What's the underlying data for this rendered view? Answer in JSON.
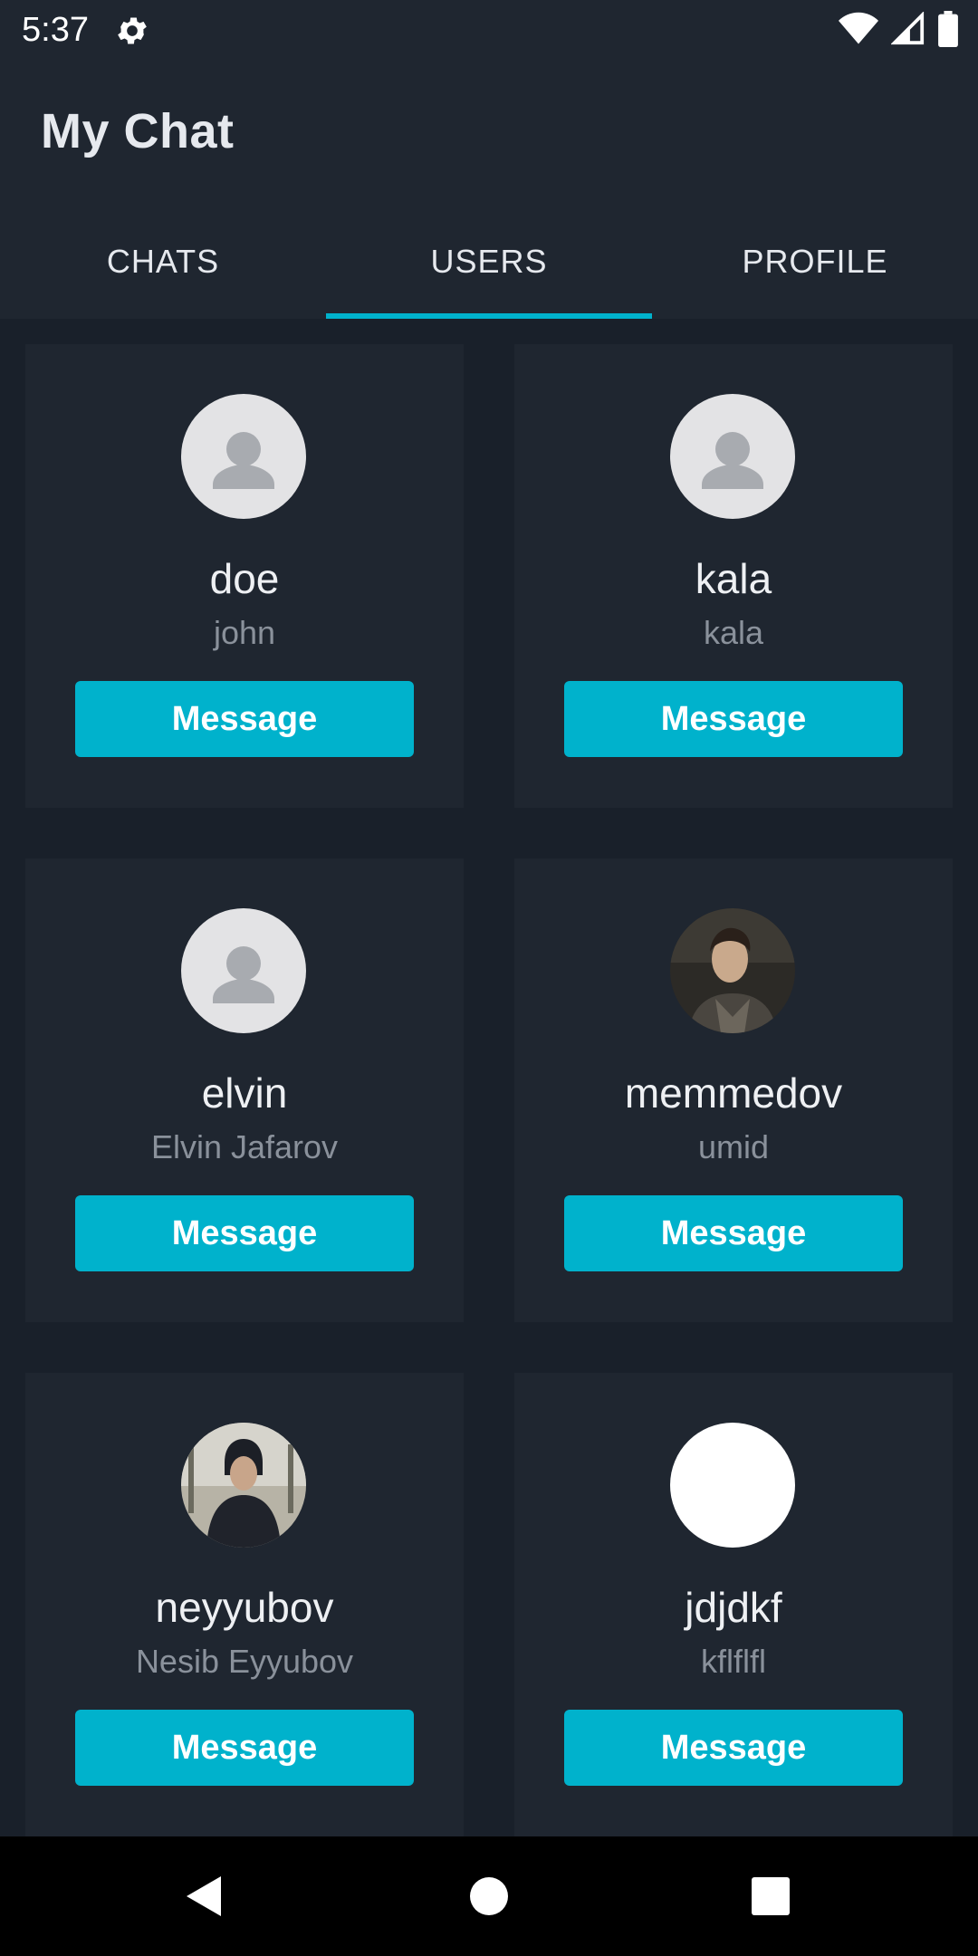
{
  "status_bar": {
    "time": "5:37",
    "icons": [
      "gear-icon",
      "wifi-icon",
      "signal-icon",
      "battery-icon"
    ]
  },
  "app": {
    "title": "My Chat",
    "tabs": [
      {
        "label": "CHATS",
        "active": false
      },
      {
        "label": "USERS",
        "active": true
      },
      {
        "label": "PROFILE",
        "active": false
      }
    ],
    "accent_color": "#00b2cc"
  },
  "users": [
    {
      "name": "doe",
      "subtitle": "john",
      "avatar": "default-person-icon",
      "button": "Message"
    },
    {
      "name": "kala",
      "subtitle": "kala",
      "avatar": "default-person-icon",
      "button": "Message"
    },
    {
      "name": "elvin",
      "subtitle": "Elvin Jafarov",
      "avatar": "default-person-icon",
      "button": "Message"
    },
    {
      "name": "memmedov",
      "subtitle": "umid",
      "avatar": "photo",
      "button": "Message"
    },
    {
      "name": "neyyubov",
      "subtitle": "Nesib Eyyubov",
      "avatar": "photo",
      "button": "Message"
    },
    {
      "name": "jdjdkf",
      "subtitle": "kflflfl",
      "avatar": "blank",
      "button": "Message"
    }
  ],
  "nav_bar": {
    "icons": [
      "back-icon",
      "home-icon",
      "recents-icon"
    ]
  }
}
